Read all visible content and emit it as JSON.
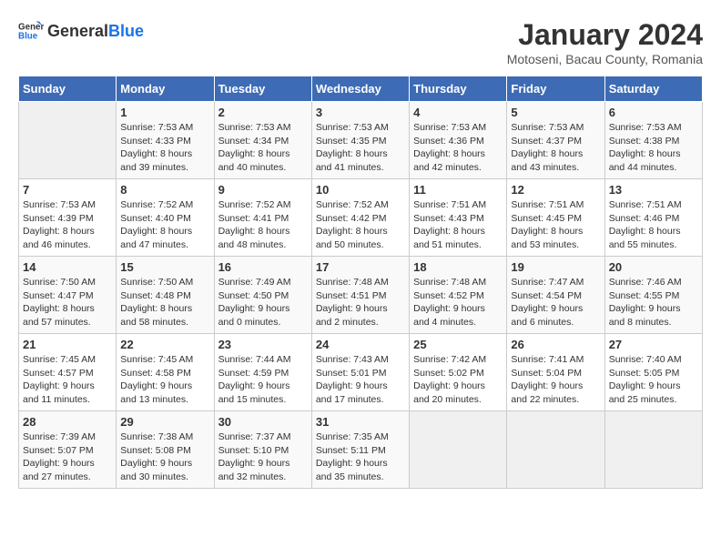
{
  "header": {
    "logo_general": "General",
    "logo_blue": "Blue",
    "month_year": "January 2024",
    "location": "Motoseni, Bacau County, Romania"
  },
  "days_of_week": [
    "Sunday",
    "Monday",
    "Tuesday",
    "Wednesday",
    "Thursday",
    "Friday",
    "Saturday"
  ],
  "weeks": [
    [
      {
        "day": "",
        "sunrise": "",
        "sunset": "",
        "daylight": ""
      },
      {
        "day": "1",
        "sunrise": "7:53 AM",
        "sunset": "4:33 PM",
        "daylight": "8 hours and 39 minutes."
      },
      {
        "day": "2",
        "sunrise": "7:53 AM",
        "sunset": "4:34 PM",
        "daylight": "8 hours and 40 minutes."
      },
      {
        "day": "3",
        "sunrise": "7:53 AM",
        "sunset": "4:35 PM",
        "daylight": "8 hours and 41 minutes."
      },
      {
        "day": "4",
        "sunrise": "7:53 AM",
        "sunset": "4:36 PM",
        "daylight": "8 hours and 42 minutes."
      },
      {
        "day": "5",
        "sunrise": "7:53 AM",
        "sunset": "4:37 PM",
        "daylight": "8 hours and 43 minutes."
      },
      {
        "day": "6",
        "sunrise": "7:53 AM",
        "sunset": "4:38 PM",
        "daylight": "8 hours and 44 minutes."
      }
    ],
    [
      {
        "day": "7",
        "sunrise": "7:53 AM",
        "sunset": "4:39 PM",
        "daylight": "8 hours and 46 minutes."
      },
      {
        "day": "8",
        "sunrise": "7:52 AM",
        "sunset": "4:40 PM",
        "daylight": "8 hours and 47 minutes."
      },
      {
        "day": "9",
        "sunrise": "7:52 AM",
        "sunset": "4:41 PM",
        "daylight": "8 hours and 48 minutes."
      },
      {
        "day": "10",
        "sunrise": "7:52 AM",
        "sunset": "4:42 PM",
        "daylight": "8 hours and 50 minutes."
      },
      {
        "day": "11",
        "sunrise": "7:51 AM",
        "sunset": "4:43 PM",
        "daylight": "8 hours and 51 minutes."
      },
      {
        "day": "12",
        "sunrise": "7:51 AM",
        "sunset": "4:45 PM",
        "daylight": "8 hours and 53 minutes."
      },
      {
        "day": "13",
        "sunrise": "7:51 AM",
        "sunset": "4:46 PM",
        "daylight": "8 hours and 55 minutes."
      }
    ],
    [
      {
        "day": "14",
        "sunrise": "7:50 AM",
        "sunset": "4:47 PM",
        "daylight": "8 hours and 57 minutes."
      },
      {
        "day": "15",
        "sunrise": "7:50 AM",
        "sunset": "4:48 PM",
        "daylight": "8 hours and 58 minutes."
      },
      {
        "day": "16",
        "sunrise": "7:49 AM",
        "sunset": "4:50 PM",
        "daylight": "9 hours and 0 minutes."
      },
      {
        "day": "17",
        "sunrise": "7:48 AM",
        "sunset": "4:51 PM",
        "daylight": "9 hours and 2 minutes."
      },
      {
        "day": "18",
        "sunrise": "7:48 AM",
        "sunset": "4:52 PM",
        "daylight": "9 hours and 4 minutes."
      },
      {
        "day": "19",
        "sunrise": "7:47 AM",
        "sunset": "4:54 PM",
        "daylight": "9 hours and 6 minutes."
      },
      {
        "day": "20",
        "sunrise": "7:46 AM",
        "sunset": "4:55 PM",
        "daylight": "9 hours and 8 minutes."
      }
    ],
    [
      {
        "day": "21",
        "sunrise": "7:45 AM",
        "sunset": "4:57 PM",
        "daylight": "9 hours and 11 minutes."
      },
      {
        "day": "22",
        "sunrise": "7:45 AM",
        "sunset": "4:58 PM",
        "daylight": "9 hours and 13 minutes."
      },
      {
        "day": "23",
        "sunrise": "7:44 AM",
        "sunset": "4:59 PM",
        "daylight": "9 hours and 15 minutes."
      },
      {
        "day": "24",
        "sunrise": "7:43 AM",
        "sunset": "5:01 PM",
        "daylight": "9 hours and 17 minutes."
      },
      {
        "day": "25",
        "sunrise": "7:42 AM",
        "sunset": "5:02 PM",
        "daylight": "9 hours and 20 minutes."
      },
      {
        "day": "26",
        "sunrise": "7:41 AM",
        "sunset": "5:04 PM",
        "daylight": "9 hours and 22 minutes."
      },
      {
        "day": "27",
        "sunrise": "7:40 AM",
        "sunset": "5:05 PM",
        "daylight": "9 hours and 25 minutes."
      }
    ],
    [
      {
        "day": "28",
        "sunrise": "7:39 AM",
        "sunset": "5:07 PM",
        "daylight": "9 hours and 27 minutes."
      },
      {
        "day": "29",
        "sunrise": "7:38 AM",
        "sunset": "5:08 PM",
        "daylight": "9 hours and 30 minutes."
      },
      {
        "day": "30",
        "sunrise": "7:37 AM",
        "sunset": "5:10 PM",
        "daylight": "9 hours and 32 minutes."
      },
      {
        "day": "31",
        "sunrise": "7:35 AM",
        "sunset": "5:11 PM",
        "daylight": "9 hours and 35 minutes."
      },
      {
        "day": "",
        "sunrise": "",
        "sunset": "",
        "daylight": ""
      },
      {
        "day": "",
        "sunrise": "",
        "sunset": "",
        "daylight": ""
      },
      {
        "day": "",
        "sunrise": "",
        "sunset": "",
        "daylight": ""
      }
    ]
  ],
  "labels": {
    "sunrise_prefix": "Sunrise: ",
    "sunset_prefix": "Sunset: ",
    "daylight_prefix": "Daylight: "
  }
}
